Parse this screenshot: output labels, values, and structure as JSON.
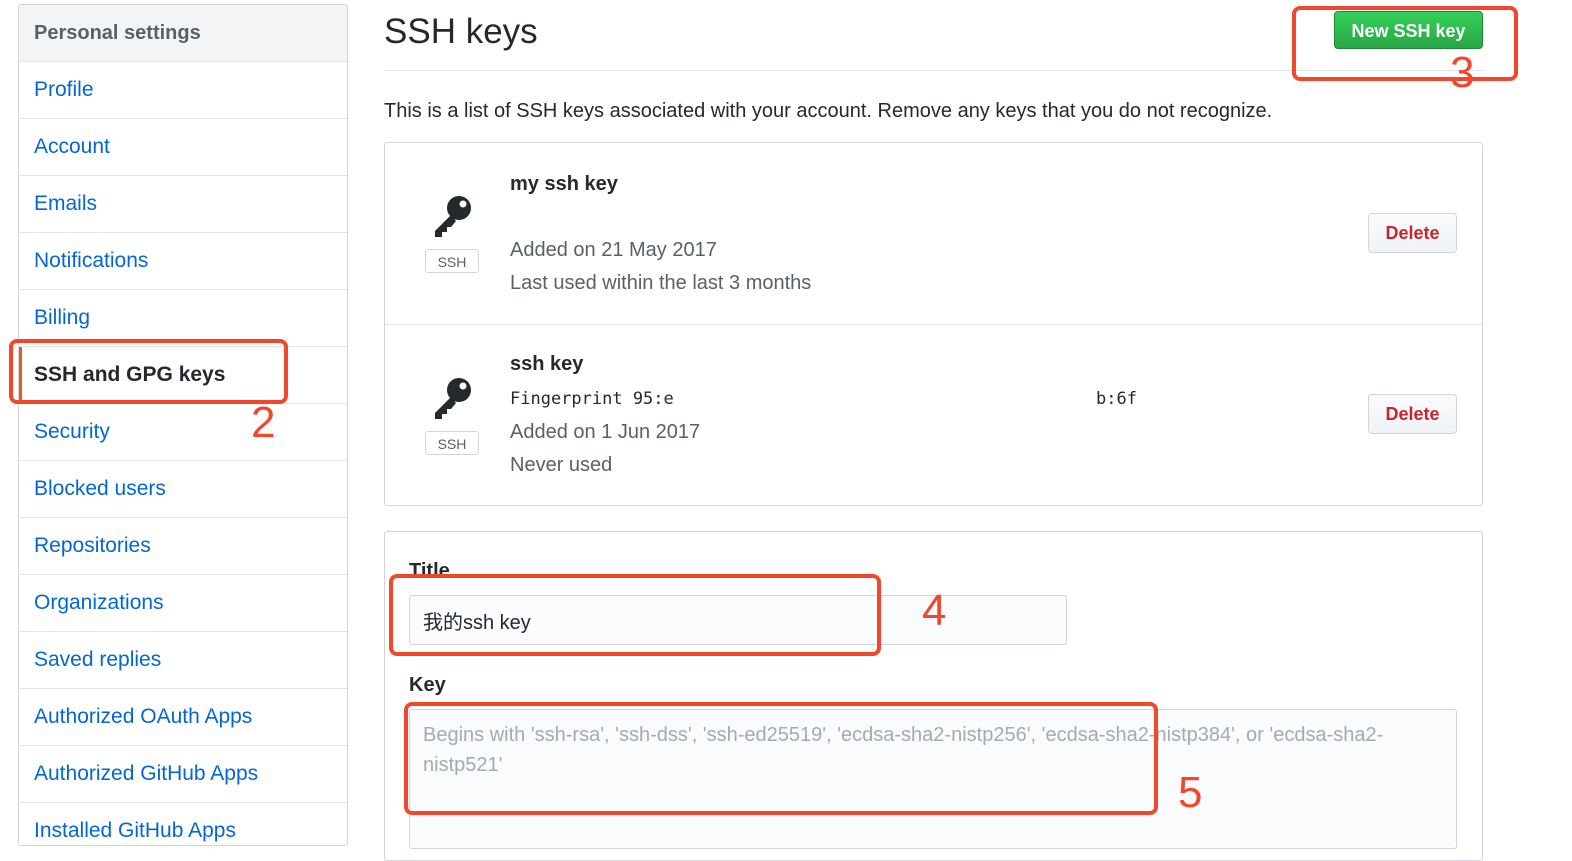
{
  "sidebar": {
    "header": "Personal settings",
    "items": [
      {
        "label": "Profile"
      },
      {
        "label": "Account"
      },
      {
        "label": "Emails"
      },
      {
        "label": "Notifications"
      },
      {
        "label": "Billing"
      },
      {
        "label": "SSH and GPG keys",
        "selected": true
      },
      {
        "label": "Security"
      },
      {
        "label": "Blocked users"
      },
      {
        "label": "Repositories"
      },
      {
        "label": "Organizations"
      },
      {
        "label": "Saved replies"
      },
      {
        "label": "Authorized OAuth Apps"
      },
      {
        "label": "Authorized GitHub Apps"
      },
      {
        "label": "Installed GitHub Apps"
      }
    ]
  },
  "main": {
    "title": "SSH keys",
    "new_key_button": "New SSH key",
    "intro": "This is a list of SSH keys associated with your account. Remove any keys that you do not recognize.",
    "keys": [
      {
        "name": "my ssh key",
        "fingerprint": "",
        "added": "Added on 21 May 2017",
        "last_used": "Last used within the last 3 months",
        "badge": "SSH",
        "delete_label": "Delete"
      },
      {
        "name": "ssh key",
        "fingerprint": "Fingerprint 95:e",
        "fingerprint_tail": "b:6f",
        "added": "Added on 1 Jun 2017",
        "last_used": "Never used",
        "badge": "SSH",
        "delete_label": "Delete"
      }
    ],
    "form": {
      "title_label": "Title",
      "title_value": "我的ssh key",
      "key_label": "Key",
      "key_placeholder": "Begins with 'ssh-rsa', 'ssh-dss', 'ssh-ed25519', 'ecdsa-sha2-nistp256', 'ecdsa-sha2-nistp384', or 'ecdsa-sha2-nistp521'"
    }
  },
  "annotations": [
    "2",
    "3",
    "4",
    "5"
  ],
  "colors": {
    "accent": "#0366d6",
    "annotation": "#f2472c",
    "primary_button": "#28a745",
    "danger": "#cb2431",
    "selected_marker": "#e36209"
  },
  "icons": {
    "key": "key-icon"
  }
}
